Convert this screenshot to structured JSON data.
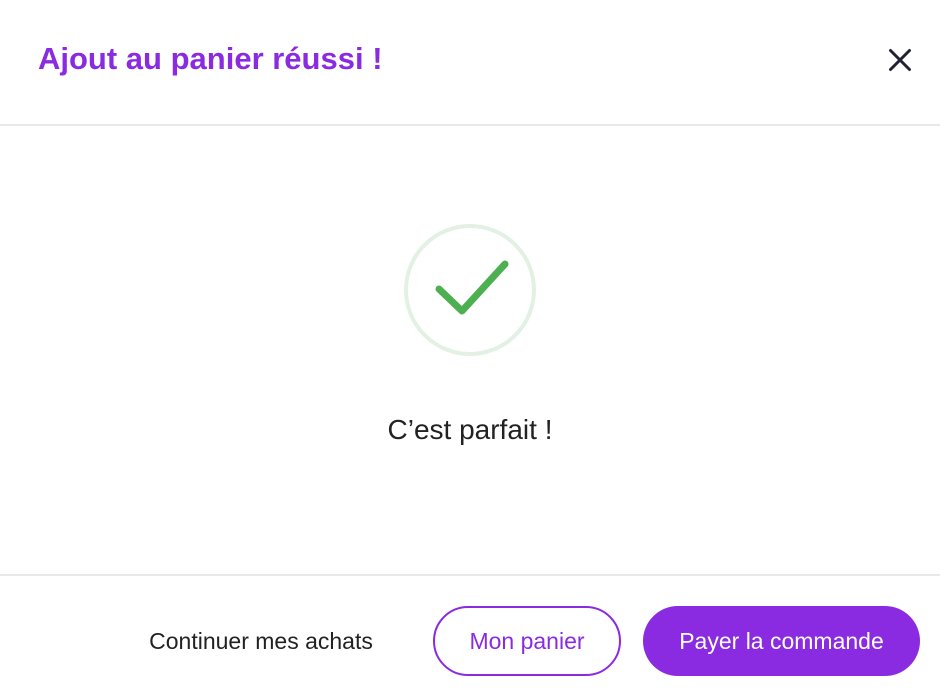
{
  "colors": {
    "accent": "#8a2be2",
    "success": "#4caf50",
    "success_ring": "#e2f1e3",
    "text": "#222222",
    "divider": "#e9e9ec"
  },
  "header": {
    "title": "Ajout au panier réussi !",
    "close_icon": "close-icon"
  },
  "body": {
    "status_icon": "checkmark-circle-icon",
    "message": "C’est parfait !"
  },
  "footer": {
    "continue_label": "Continuer mes achats",
    "cart_label": "Mon panier",
    "pay_label": "Payer la commande"
  }
}
